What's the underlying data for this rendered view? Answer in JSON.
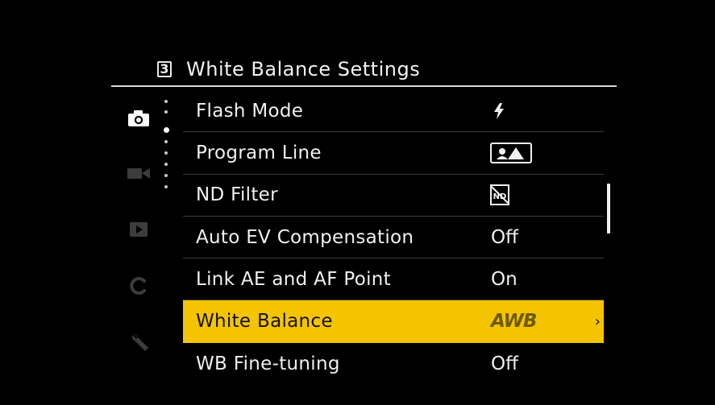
{
  "header": {
    "page_number": "3",
    "title": "White Balance Settings"
  },
  "tabs": [
    {
      "name": "camera-tab",
      "icon": "camera-icon",
      "active": true
    },
    {
      "name": "movie-tab",
      "icon": "video-camera-icon",
      "active": false
    },
    {
      "name": "playback-tab",
      "icon": "play-icon",
      "active": false
    },
    {
      "name": "custom-tab",
      "icon": "letter-c-icon",
      "active": false
    },
    {
      "name": "setup-tab",
      "icon": "wrench-icon",
      "active": false
    }
  ],
  "menu": {
    "items": [
      {
        "label": "Flash Mode",
        "value": "",
        "value_icon": "flash-icon"
      },
      {
        "label": "Program Line",
        "value": "",
        "value_icon": "program-line-icon"
      },
      {
        "label": "ND Filter",
        "value": "",
        "value_icon": "nd-filter-off-icon"
      },
      {
        "label": "Auto EV Compensation",
        "value": "Off"
      },
      {
        "label": "Link AE and AF Point",
        "value": "On"
      },
      {
        "label": "White Balance",
        "value": "AWB",
        "selected": true,
        "has_submenu": true
      },
      {
        "label": "WB Fine-tuning",
        "value": "Off"
      }
    ],
    "submenu_arrow": "›"
  },
  "colors": {
    "background": "#000000",
    "text": "#f0f0f0",
    "highlight": "#f5c400",
    "divider": "#3a3a3a"
  }
}
